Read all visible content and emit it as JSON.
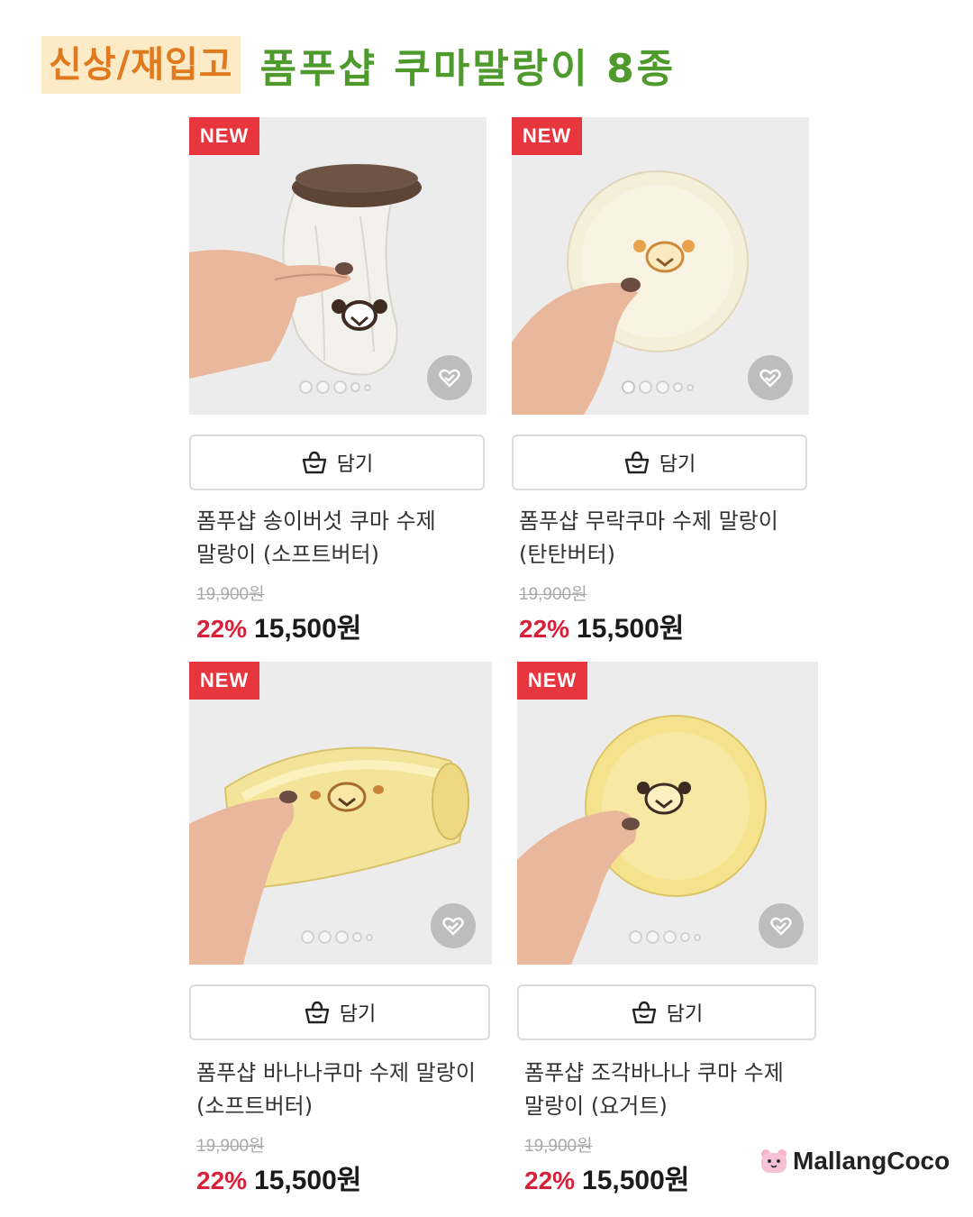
{
  "header": {
    "tag": "신상/재입고",
    "title": "폼푸샵 쿠마말랑이 8종"
  },
  "products": [
    {
      "badge": "NEW",
      "cart_label": "담기",
      "name": "폼푸샵 송이버섯 쿠마 수제 말랑이 (소프트버터)",
      "original_price": "19,900원",
      "discount": "22%",
      "price": "15,500원"
    },
    {
      "badge": "NEW",
      "cart_label": "담기",
      "name": "폼푸샵 무락쿠마 수제 말랑이 (탄탄버터)",
      "original_price": "19,900원",
      "discount": "22%",
      "price": "15,500원"
    },
    {
      "badge": "NEW",
      "cart_label": "담기",
      "name": "폼푸샵 바나나쿠마 수제 말랑이 (소프트버터)",
      "original_price": "19,900원",
      "discount": "22%",
      "price": "15,500원"
    },
    {
      "badge": "NEW",
      "cart_label": "담기",
      "name": "폼푸샵 조각바나나 쿠마 수제 말랑이 (요거트)",
      "original_price": "19,900원",
      "discount": "22%",
      "price": "15,500원"
    }
  ],
  "brand": {
    "name": "MallangCoco",
    "icon": "pink-bear-logo-icon"
  },
  "colors": {
    "badge": "#e8363f",
    "discount": "#d7213a",
    "title": "#4f9a2c",
    "tag_text": "#e07a1f",
    "tag_bg": "#fdebc8"
  }
}
